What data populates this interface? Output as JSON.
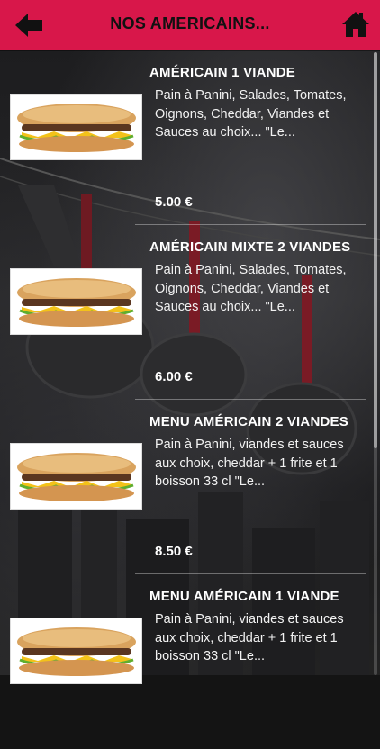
{
  "header": {
    "title": "NOS AMERICAINS...",
    "back_icon": "back-arrow-icon",
    "home_icon": "home-icon"
  },
  "colors": {
    "header_bg": "#d8174a"
  },
  "items": [
    {
      "name": "AMÉRICAIN 1 VIANDE",
      "description": "Pain à Panini, Salades, Tomates, Oignons, Cheddar, Viandes et Sauces au choix... \"Le...",
      "price": "5.00 €"
    },
    {
      "name": "AMÉRICAIN MIXTE 2 VIANDES",
      "description": "Pain à Panini, Salades, Tomates, Oignons, Cheddar, Viandes et Sauces au choix... \"Le...",
      "price": "6.00 €"
    },
    {
      "name": "MENU AMÉRICAIN 2 VIANDES",
      "description": "Pain à Panini, viandes et sauces aux choix, cheddar + 1 frite et 1 boisson 33 cl \"Le...",
      "price": "8.50 €"
    },
    {
      "name": "MENU AMÉRICAIN 1 VIANDE",
      "description": "Pain à Panini, viandes et sauces aux choix, cheddar + 1 frite et 1 boisson 33 cl \"Le...",
      "price": ""
    }
  ]
}
